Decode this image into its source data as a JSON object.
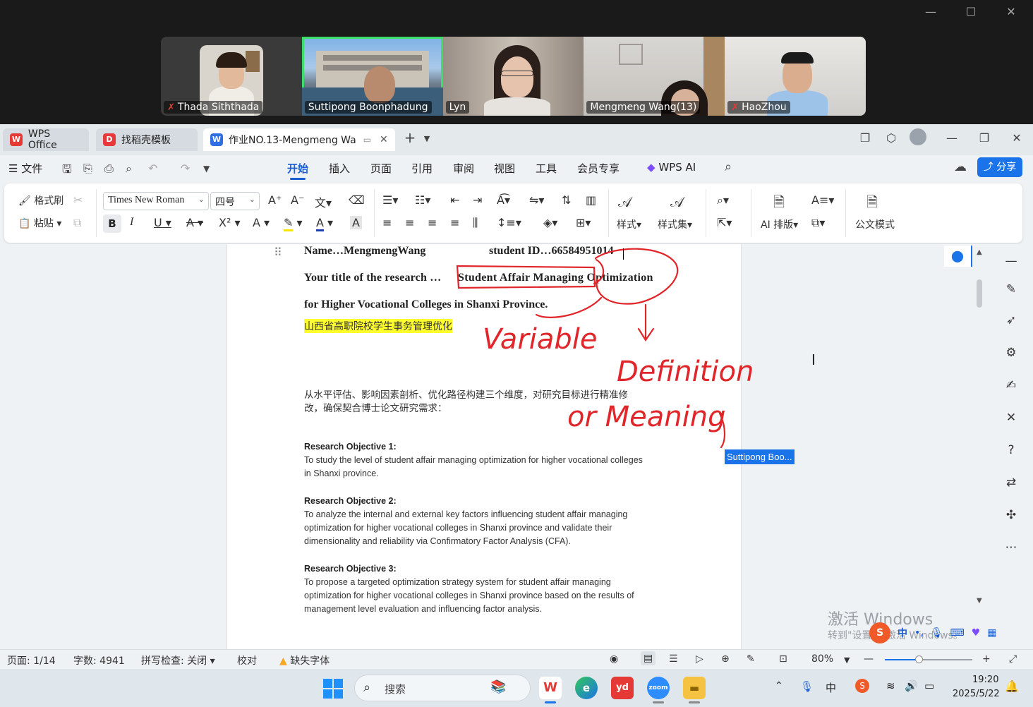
{
  "zoom": {
    "participants": [
      {
        "name": "Thada Siththada",
        "muted": true
      },
      {
        "name": "Suttipong Boonphadung",
        "muted": false,
        "active": true
      },
      {
        "name": "Lyn",
        "muted": false
      },
      {
        "name": "Mengmeng Wang(13)",
        "muted": false
      },
      {
        "name": "HaoZhou",
        "muted": true
      }
    ],
    "window_controls": [
      "—",
      "☐",
      "✕"
    ]
  },
  "wps": {
    "tabs": [
      {
        "label": "WPS Office",
        "icon": "wps-logo"
      },
      {
        "label": "找稻壳模板",
        "icon": "docer-logo"
      },
      {
        "label": "作业NO.13-Mengmeng Wa",
        "icon": "word-doc-icon",
        "active": true
      }
    ],
    "new_tab": "+",
    "menu": {
      "file": "文件",
      "items": [
        "开始",
        "插入",
        "页面",
        "引用",
        "审阅",
        "视图",
        "工具",
        "会员专享",
        "WPS AI"
      ],
      "active": "开始",
      "share": "分享"
    },
    "ribbon": {
      "format_painter": "格式刷",
      "paste": "粘贴",
      "font_name": "Times New Roman",
      "font_size": "四号",
      "styles": "样式",
      "style_set": "样式集",
      "ai_layout": "AI 排版",
      "official_mode": "公文模式"
    }
  },
  "document": {
    "name_line": "Name…MengmengWang",
    "student_id_line": "student ID…66584951014",
    "title_prefix": "Your title of the research …",
    "title_line1": "Student Affair Managing Optimization",
    "title_line2": "for Higher Vocational Colleges in Shanxi Province.",
    "chinese_title": "山西省高职院校学生事务管理优化",
    "chinese_note_line1": "从水平评估、影响因素剖析、优化路径构建三个维度，对研究目标进行精准修",
    "chinese_note_line2": "改，确保契合博士论文研究需求：",
    "objectives": [
      {
        "heading": "Research Objective 1:",
        "lines": [
          "To study the level of student affair managing optimization for higher vocational colleges",
          "in Shanxi province."
        ]
      },
      {
        "heading": "Research Objective 2:",
        "lines": [
          "To analyze the internal and external key factors influencing student affair managing",
          "optimization for higher vocational colleges in Shanxi province and validate their",
          "dimensionality and reliability via Confirmatory Factor Analysis (CFA)."
        ]
      },
      {
        "heading": "Research Objective 3:",
        "lines": [
          "To propose a targeted optimization strategy system for student affair managing",
          "optimization for higher vocational colleges in Shanxi province based on the results of",
          "management level evaluation and influencing factor analysis."
        ]
      }
    ],
    "annotations": {
      "variable": "Variable",
      "definition": "Definition",
      "or_meaning": "or Meaning",
      "annotator": "Suttipong Boo..."
    }
  },
  "overlay": {
    "activate_title": "激活 Windows",
    "activate_sub": "转到\"设置\"以激活 Windows。"
  },
  "statusbar": {
    "page": "页面: 1/14",
    "words": "字数: 4941",
    "spell": "拼写检查: 关闭",
    "proof": "校对",
    "missing_font": "缺失字体",
    "zoom": "80%"
  },
  "taskbar": {
    "search_placeholder": "搜索",
    "ime": "中",
    "time": "19:20",
    "date": "2025/5/22"
  },
  "colors": {
    "accent": "#1a5fd1",
    "active_tile": "#3ede6c",
    "ink": "#e0262a",
    "highlight": "#ffff2e"
  }
}
